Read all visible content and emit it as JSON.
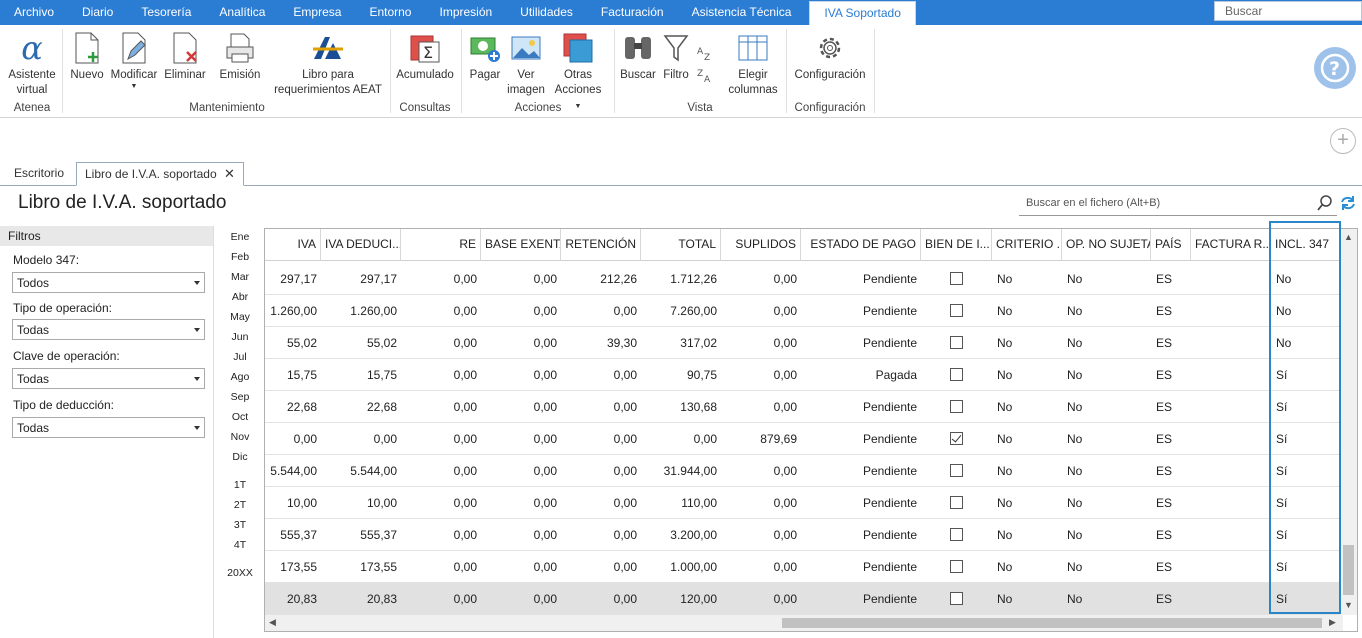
{
  "menu": {
    "items": [
      "Archivo",
      "Diario",
      "Tesorería",
      "Analítica",
      "Empresa",
      "Entorno",
      "Impresión",
      "Utilidades",
      "Facturación",
      "Asistencia Técnica",
      "IVA Soportado"
    ],
    "search_placeholder": "Buscar"
  },
  "ribbon": {
    "asistente": "Asistente virtual",
    "nuevo": "Nuevo",
    "modificar": "Modificar",
    "eliminar": "Eliminar",
    "emision": "Emisión",
    "libro_aeat": "Libro para requerimientos AEAT",
    "acumulado": "Acumulado",
    "pagar": "Pagar",
    "ver_imagen": "Ver imagen",
    "otras_acciones": "Otras Acciones",
    "buscar": "Buscar",
    "filtro": "Filtro",
    "elegir_columnas": "Elegir columnas",
    "configuracion": "Configuración",
    "groups": {
      "atenea": "Atenea",
      "mantenimiento": "Mantenimiento",
      "consultas": "Consultas",
      "acciones": "Acciones",
      "vista": "Vista",
      "configuracion": "Configuración"
    }
  },
  "tabs": {
    "escritorio": "Escritorio",
    "libro": "Libro de I.V.A. soportado"
  },
  "page_title": "Libro de I.V.A. soportado",
  "search_file_placeholder": "Buscar en el fichero (Alt+B)",
  "filters": {
    "title": "Filtros",
    "modelo_label": "Modelo 347:",
    "modelo_value": "Todos",
    "tipo_op_label": "Tipo de operación:",
    "tipo_op_value": "Todas",
    "clave_label": "Clave de operación:",
    "clave_value": "Todas",
    "deduccion_label": "Tipo de deducción:",
    "deduccion_value": "Todas"
  },
  "months": [
    "Ene",
    "Feb",
    "Mar",
    "Abr",
    "May",
    "Jun",
    "Jul",
    "Ago",
    "Sep",
    "Oct",
    "Nov",
    "Dic",
    "1T",
    "2T",
    "3T",
    "4T",
    "20XX"
  ],
  "grid": {
    "headers": [
      "IVA",
      "IVA DEDUCI...",
      "RE",
      "BASE EXENTA",
      "RETENCIÓN",
      "TOTAL",
      "SUPLIDOS",
      "ESTADO DE PAGO",
      "BIEN DE I...",
      "CRITERIO ...",
      "OP. NO SUJETA",
      "PAÍS",
      "FACTURA R...",
      "INCL. 347"
    ],
    "rows": [
      {
        "iva": "297,17",
        "ded": "297,17",
        "re": "0,00",
        "exenta": "0,00",
        "ret": "212,26",
        "total": "1.712,26",
        "sup": "0,00",
        "estado": "Pendiente",
        "bien": false,
        "crit": "No",
        "nosuj": "No",
        "pais": "ES",
        "incl": "No"
      },
      {
        "iva": "1.260,00",
        "ded": "1.260,00",
        "re": "0,00",
        "exenta": "0,00",
        "ret": "0,00",
        "total": "7.260,00",
        "sup": "0,00",
        "estado": "Pendiente",
        "bien": false,
        "crit": "No",
        "nosuj": "No",
        "pais": "ES",
        "incl": "No"
      },
      {
        "iva": "55,02",
        "ded": "55,02",
        "re": "0,00",
        "exenta": "0,00",
        "ret": "39,30",
        "total": "317,02",
        "sup": "0,00",
        "estado": "Pendiente",
        "bien": false,
        "crit": "No",
        "nosuj": "No",
        "pais": "ES",
        "incl": "No"
      },
      {
        "iva": "15,75",
        "ded": "15,75",
        "re": "0,00",
        "exenta": "0,00",
        "ret": "0,00",
        "total": "90,75",
        "sup": "0,00",
        "estado": "Pagada",
        "bien": false,
        "crit": "No",
        "nosuj": "No",
        "pais": "ES",
        "incl": "Sí"
      },
      {
        "iva": "22,68",
        "ded": "22,68",
        "re": "0,00",
        "exenta": "0,00",
        "ret": "0,00",
        "total": "130,68",
        "sup": "0,00",
        "estado": "Pendiente",
        "bien": false,
        "crit": "No",
        "nosuj": "No",
        "pais": "ES",
        "incl": "Sí"
      },
      {
        "iva": "0,00",
        "ded": "0,00",
        "re": "0,00",
        "exenta": "0,00",
        "ret": "0,00",
        "total": "0,00",
        "sup": "879,69",
        "estado": "Pendiente",
        "bien": true,
        "crit": "No",
        "nosuj": "No",
        "pais": "ES",
        "incl": "Sí"
      },
      {
        "iva": "5.544,00",
        "ded": "5.544,00",
        "re": "0,00",
        "exenta": "0,00",
        "ret": "0,00",
        "total": "31.944,00",
        "sup": "0,00",
        "estado": "Pendiente",
        "bien": false,
        "crit": "No",
        "nosuj": "No",
        "pais": "ES",
        "incl": "Sí"
      },
      {
        "iva": "10,00",
        "ded": "10,00",
        "re": "0,00",
        "exenta": "0,00",
        "ret": "0,00",
        "total": "110,00",
        "sup": "0,00",
        "estado": "Pendiente",
        "bien": false,
        "crit": "No",
        "nosuj": "No",
        "pais": "ES",
        "incl": "Sí"
      },
      {
        "iva": "555,37",
        "ded": "555,37",
        "re": "0,00",
        "exenta": "0,00",
        "ret": "0,00",
        "total": "3.200,00",
        "sup": "0,00",
        "estado": "Pendiente",
        "bien": false,
        "crit": "No",
        "nosuj": "No",
        "pais": "ES",
        "incl": "Sí"
      },
      {
        "iva": "173,55",
        "ded": "173,55",
        "re": "0,00",
        "exenta": "0,00",
        "ret": "0,00",
        "total": "1.000,00",
        "sup": "0,00",
        "estado": "Pendiente",
        "bien": false,
        "crit": "No",
        "nosuj": "No",
        "pais": "ES",
        "incl": "Sí"
      },
      {
        "iva": "20,83",
        "ded": "20,83",
        "re": "0,00",
        "exenta": "0,00",
        "ret": "0,00",
        "total": "120,00",
        "sup": "0,00",
        "estado": "Pendiente",
        "bien": false,
        "crit": "No",
        "nosuj": "No",
        "pais": "ES",
        "incl": "Sí"
      }
    ]
  },
  "colors": {
    "accent": "#2b7cd3",
    "highlight": "#2a86c8",
    "selected_row": "#e1e1e1"
  }
}
